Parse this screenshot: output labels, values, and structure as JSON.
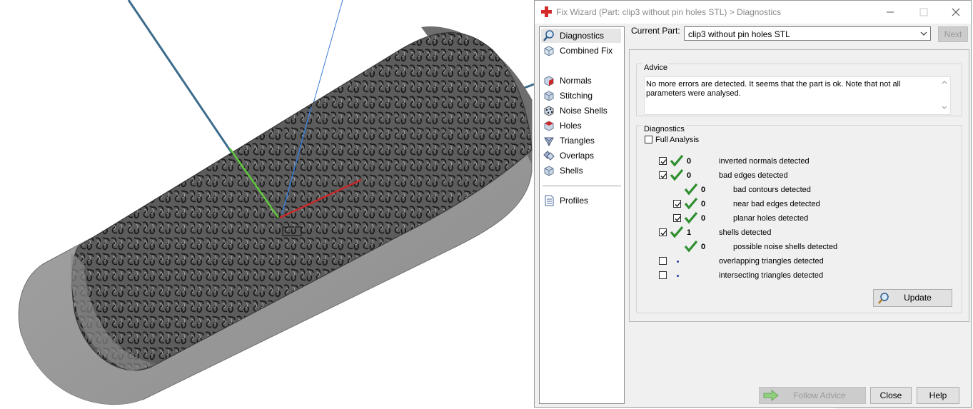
{
  "window": {
    "title": "Fix Wizard (Part: clip3 without pin holes STL) > Diagnostics"
  },
  "nav": {
    "items": [
      {
        "label": "Diagnostics"
      },
      {
        "label": "Combined Fix"
      },
      {
        "label": "Normals"
      },
      {
        "label": "Stitching"
      },
      {
        "label": "Noise Shells"
      },
      {
        "label": "Holes"
      },
      {
        "label": "Triangles"
      },
      {
        "label": "Overlaps"
      },
      {
        "label": "Shells"
      },
      {
        "label": "Profiles"
      }
    ]
  },
  "current_part": {
    "label": "Current Part:",
    "value": "clip3 without pin holes STL"
  },
  "buttons": {
    "next": "Next",
    "update": "Update",
    "follow_advice": "Follow Advice",
    "close": "Close",
    "help": "Help"
  },
  "advice": {
    "title": "Advice",
    "text": "No more errors are detected. It seems that the part is ok. Note that not all parameters were analysed."
  },
  "diagnostics": {
    "title": "Diagnostics",
    "full_analysis": "Full Analysis",
    "rows": [
      {
        "count": "0",
        "label": "inverted normals detected"
      },
      {
        "count": "0",
        "label": "bad edges detected"
      },
      {
        "count": "0",
        "label": "bad contours detected"
      },
      {
        "count": "0",
        "label": "near bad edges detected"
      },
      {
        "count": "0",
        "label": "planar holes detected"
      },
      {
        "count": "1",
        "label": "shells detected"
      },
      {
        "count": "0",
        "label": "possible noise shells detected"
      },
      {
        "count": "",
        "label": "overlapping triangles detected"
      },
      {
        "count": "",
        "label": "intersecting triangles detected"
      }
    ]
  },
  "colors": {
    "check_green": "#2f8f2f",
    "axis_green": "#5ec83b",
    "axis_red": "#c8282a",
    "axis_blue": "#3a7bd5"
  }
}
